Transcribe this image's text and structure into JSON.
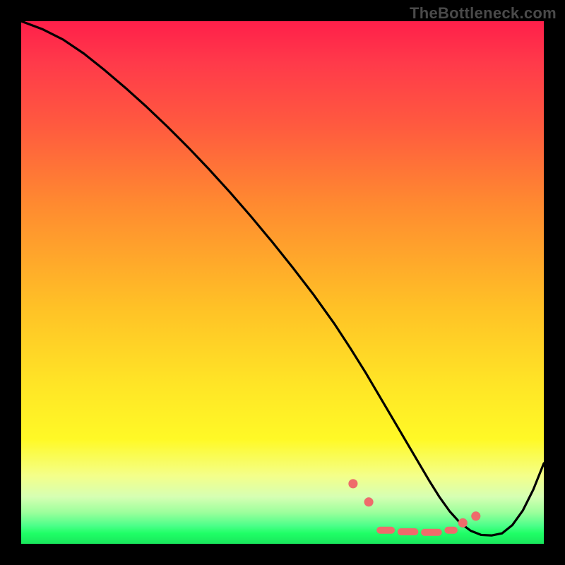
{
  "watermark": "TheBottleneck.com",
  "chart_data": {
    "type": "line",
    "title": "",
    "xlabel": "",
    "ylabel": "",
    "xlim": [
      0,
      100
    ],
    "ylim": [
      0,
      100
    ],
    "series": [
      {
        "name": "curve",
        "x": [
          0,
          4,
          8,
          12,
          16,
          20,
          24,
          28,
          32,
          36,
          40,
          44,
          48,
          52,
          56,
          60,
          63,
          66,
          68,
          70,
          72,
          74,
          76,
          78,
          80,
          82,
          84,
          86,
          88,
          90,
          92,
          94,
          96,
          98,
          100
        ],
        "y": [
          100,
          98.5,
          96.5,
          93.8,
          90.6,
          87.2,
          83.6,
          79.8,
          75.8,
          71.6,
          67.2,
          62.6,
          57.8,
          52.8,
          47.6,
          42.0,
          37.4,
          32.6,
          29.2,
          25.8,
          22.4,
          19.0,
          15.6,
          12.2,
          9.0,
          6.2,
          4.0,
          2.5,
          1.7,
          1.6,
          2.0,
          3.6,
          6.4,
          10.4,
          15.4
        ]
      }
    ],
    "markers": {
      "dots_x": [
        63.5,
        66.5,
        84.5,
        87.0
      ],
      "dots_y": [
        11.5,
        8.0,
        4.0,
        5.3
      ],
      "dashes": [
        {
          "x0": 68.0,
          "x1": 71.5,
          "y": 2.6
        },
        {
          "x0": 72.0,
          "x1": 76.0,
          "y": 2.3
        },
        {
          "x0": 76.5,
          "x1": 80.5,
          "y": 2.2
        },
        {
          "x0": 81.0,
          "x1": 83.5,
          "y": 2.6
        }
      ]
    },
    "background_gradient": {
      "stops": [
        {
          "pos": 0,
          "color": "#ff1f4a"
        },
        {
          "pos": 0.35,
          "color": "#ff8a30"
        },
        {
          "pos": 0.7,
          "color": "#ffe626"
        },
        {
          "pos": 0.9,
          "color": "#d6ffb3"
        },
        {
          "pos": 1.0,
          "color": "#19e65c"
        }
      ]
    }
  }
}
